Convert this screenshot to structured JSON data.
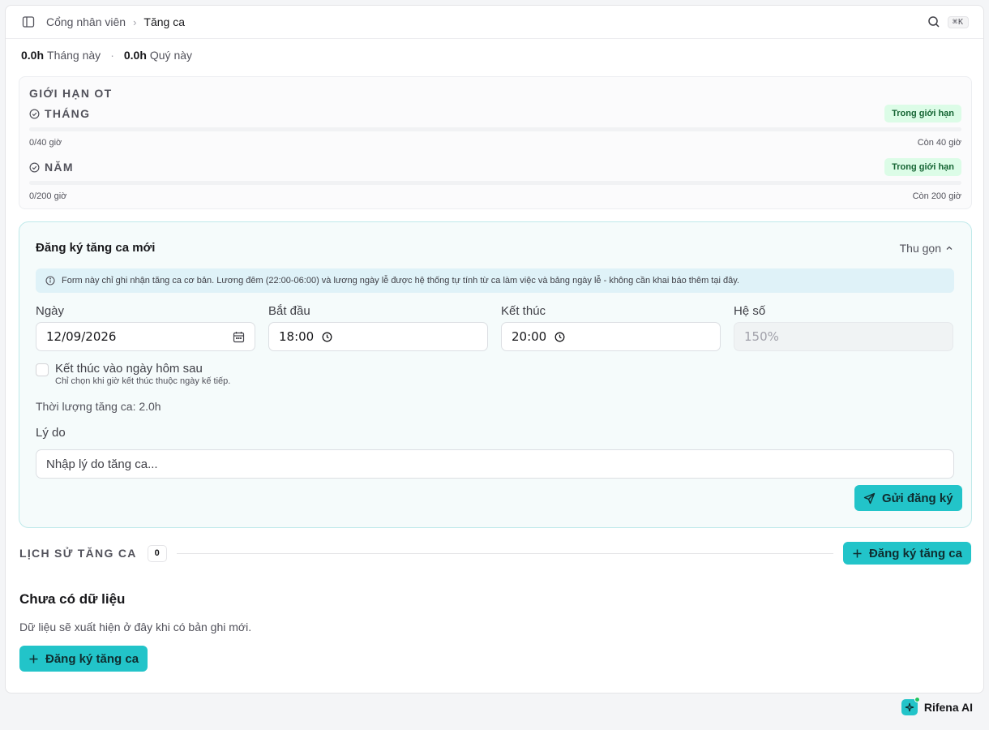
{
  "header": {
    "breadcrumb_parent": "Cổng nhân viên",
    "breadcrumb_current": "Tăng ca",
    "shortcut": "⌘K"
  },
  "stats": {
    "month_value": "0.0h",
    "month_label": "Tháng này",
    "quarter_value": "0.0h",
    "quarter_label": "Quý này"
  },
  "limits": {
    "title": "GIỚI HẠN OT",
    "items": [
      {
        "label": "THÁNG",
        "status": "Trong giới hạn",
        "used": "0/40 giờ",
        "remaining": "Còn 40 giờ",
        "progress": 0
      },
      {
        "label": "NĂM",
        "status": "Trong giới hạn",
        "used": "0/200 giờ",
        "remaining": "Còn 200 giờ",
        "progress": 0
      }
    ]
  },
  "form": {
    "title": "Đăng ký tăng ca mới",
    "collapse_label": "Thu gọn",
    "note": "Form này chỉ ghi nhận tăng ca cơ bản. Lương đêm (22:00-06:00) và lương ngày lễ được hệ thống tự tính từ ca làm việc và bảng ngày lễ - không cần khai báo thêm tại đây.",
    "date_label": "Ngày",
    "date_value": "12/09/2026",
    "start_label": "Bắt đầu",
    "start_value": "18:00",
    "end_label": "Kết thúc",
    "end_value": "20:00",
    "coef_label": "Hệ số",
    "coef_value": "150%",
    "next_day_label": "Kết thúc vào ngày hôm sau",
    "next_day_help": "Chỉ chọn khi giờ kết thúc thuộc ngày kế tiếp.",
    "duration": "Thời lượng tăng ca: 2.0h",
    "reason_label": "Lý do",
    "reason_placeholder": "Nhập lý do tăng ca...",
    "submit_label": "Gửi đăng ký"
  },
  "history": {
    "title": "LỊCH SỬ TĂNG CA",
    "count": "0",
    "register_label": "Đăng ký tăng ca"
  },
  "empty": {
    "title": "Chưa có dữ liệu",
    "description": "Dữ liệu sẽ xuất hiện ở đây khi có bản ghi mới.",
    "button_label": "Đăng ký tăng ca"
  },
  "assistant": {
    "label": "Rifena AI"
  },
  "colors": {
    "accent": "#22c4c9",
    "success_bg": "#dcfce7",
    "success_text": "#166534",
    "note_bg": "#dff2f8"
  }
}
